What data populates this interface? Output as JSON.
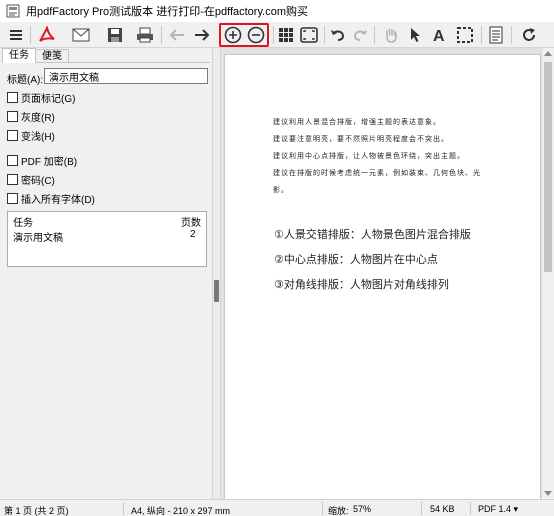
{
  "window": {
    "title": "用pdfFactory Pro测试版本 进行打印-在pdffactory.com购买"
  },
  "toolbar": {
    "buttons": [
      "menu-icon",
      "pdf-icon",
      "mail-icon",
      "save-icon",
      "print-icon",
      "back-arrow-icon",
      "forward-arrow-icon",
      "zoom-in-icon",
      "zoom-out-icon",
      "thumbnails-icon",
      "fit-page-icon",
      "undo-icon",
      "redo-icon",
      "hand-tool-icon",
      "select-arrow-icon",
      "text-tool-icon",
      "marquee-select-icon",
      "document-info-icon",
      "refresh-icon"
    ],
    "highlight_color": "#e0141e"
  },
  "left_panel": {
    "tabs": [
      "任务",
      "便笺"
    ],
    "title_label": "标题(A):",
    "title_value": "演示用文稿",
    "options": [
      "页面标记(G)",
      "灰度(R)",
      "变浅(H)",
      "PDF 加密(B)",
      "密码(C)",
      "插入所有字体(D)"
    ],
    "task_table": {
      "headers": [
        "任务",
        "页数"
      ],
      "rows": [
        {
          "name": "演示用文稿",
          "pages": "2"
        }
      ]
    }
  },
  "document": {
    "small_lines": [
      "建议利用人景混合排版，增强主题的表达意象。",
      "建议要注意明亮，要不然照片明亮程度会不突出。",
      "建议利用中心点排版，让人物被景色环绕，突出主题。",
      "建议在排版的时候考虑统一元素，例如装束、几何色块、光",
      "影。"
    ],
    "big_lines": [
      "①人景交错排版：人物景色图片混合排版",
      "②中心点排版：人物图片在中心点",
      "③对角线排版：人物图片对角线排列"
    ]
  },
  "status": {
    "page": "第 1 页 (共 2 页)",
    "paper": "A4, 纵向 - 210 x 297 mm",
    "zoom_label": "缩放:",
    "zoom_value": "57%",
    "size": "54 KB",
    "pdf_version": "PDF 1.4 ▾"
  }
}
